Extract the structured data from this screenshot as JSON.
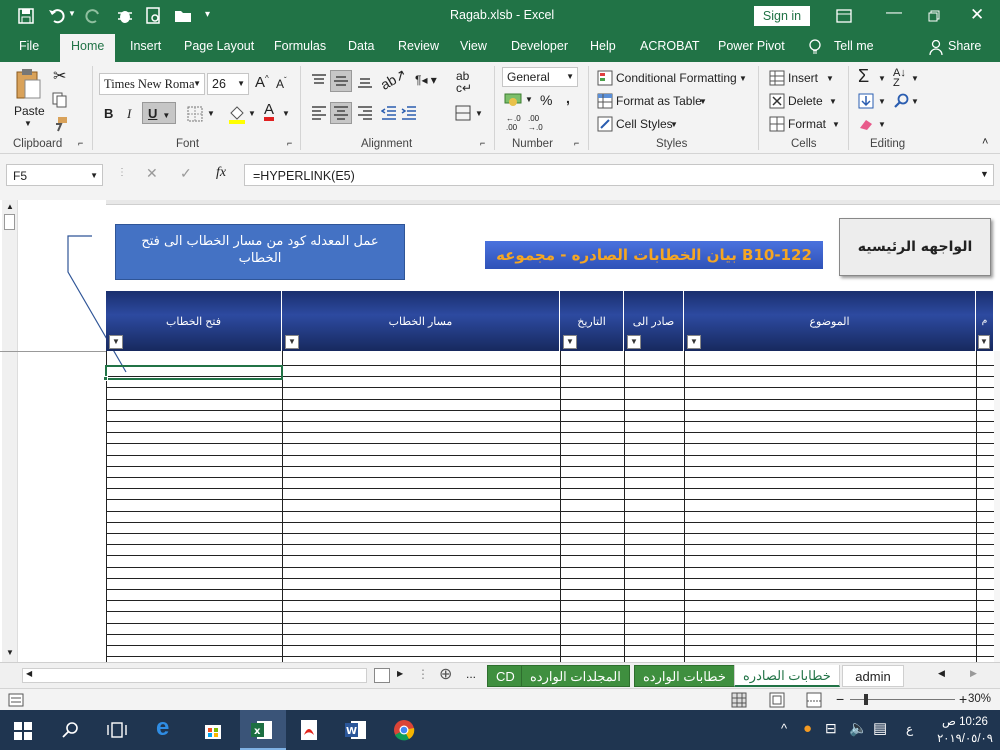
{
  "window": {
    "title": "Ragab.xlsb  -  Excel",
    "sign_in": "Sign in"
  },
  "ribbon_tabs": [
    {
      "label": "File"
    },
    {
      "label": "Home"
    },
    {
      "label": "Insert"
    },
    {
      "label": "Page Layout"
    },
    {
      "label": "Formulas"
    },
    {
      "label": "Data"
    },
    {
      "label": "Review"
    },
    {
      "label": "View"
    },
    {
      "label": "Developer"
    },
    {
      "label": "Help"
    },
    {
      "label": "ACROBAT"
    },
    {
      "label": "Power Pivot"
    }
  ],
  "tell_me": "Tell me",
  "share": "Share",
  "clipboard": {
    "paste": "Paste",
    "group": "Clipboard"
  },
  "font": {
    "name": "Times New Roma",
    "size": "26",
    "bold": "B",
    "italic": "I",
    "underline": "U",
    "group": "Font"
  },
  "alignment": {
    "group": "Alignment"
  },
  "number": {
    "format": "General",
    "percent": "%",
    "comma": ",",
    "group": "Number"
  },
  "styles": {
    "conditional": "Conditional Formatting",
    "table": "Format as Table",
    "cell": "Cell Styles",
    "group": "Styles"
  },
  "cells": {
    "insert": "Insert",
    "delete": "Delete",
    "format": "Format",
    "group": "Cells"
  },
  "editing": {
    "group": "Editing"
  },
  "formula_bar": {
    "name_box": "F5",
    "fx": "fx",
    "formula": "=HYPERLINK(E5)"
  },
  "sheet": {
    "home_button": "الواجهه الرئيسيه",
    "banner": "بيان الخطابات الصادره - مجموعه B10-122",
    "note": "عمل المعدله كود من مسار الخطاب الى فتح الخطاب",
    "headers": [
      "فتح الخطاب",
      "مسار الخطاب",
      "التاريخ",
      "صادر الى",
      "الموضوع",
      "م"
    ],
    "row_count": 27
  },
  "sheet_tabs": [
    {
      "label": "CD"
    },
    {
      "label": "المجلدات الوارده"
    },
    {
      "label": "خطابات الوارده"
    },
    {
      "label": "خطابات الصادره"
    },
    {
      "label": "admin"
    }
  ],
  "status": {
    "zoom": "30%"
  },
  "taskbar": {
    "time": "10:26 ص",
    "date": "٢٠١٩/٠٥/٠٩",
    "lang": "ع"
  },
  "colors": {
    "excel_green": "#217346",
    "header_navy": "#1a2f6e",
    "banner_blue": "#3a5fcf",
    "banner_text": "#f5a623"
  }
}
